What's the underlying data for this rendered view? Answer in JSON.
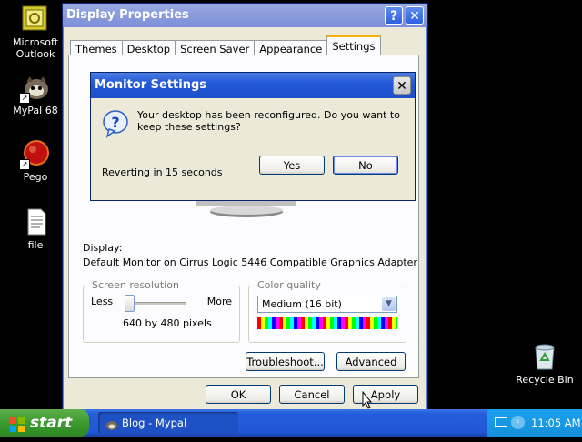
{
  "desktop": {
    "icons": [
      {
        "label_line1": "Microsoft",
        "label_line2": "Outlook",
        "icon": "outlook-icon"
      },
      {
        "label_line1": "MyPal 68",
        "label_line2": "",
        "icon": "mypal-icon"
      },
      {
        "label_line1": "Pego",
        "label_line2": "",
        "icon": "pego-icon"
      },
      {
        "label_line1": "file",
        "label_line2": "",
        "icon": "file-icon"
      },
      {
        "label_line1": "Recycle Bin",
        "label_line2": "",
        "icon": "recycle-bin-icon"
      }
    ]
  },
  "display_properties": {
    "title": "Display Properties",
    "tabs": [
      "Themes",
      "Desktop",
      "Screen Saver",
      "Appearance",
      "Settings"
    ],
    "active_tab": "Settings",
    "display_label": "Display:",
    "display_value": "Default Monitor on Cirrus Logic 5446 Compatible Graphics Adapter",
    "screen_resolution": {
      "group_label": "Screen resolution",
      "less": "Less",
      "more": "More",
      "value": "640 by 480 pixels",
      "slider_level": 0
    },
    "color_quality": {
      "group_label": "Color quality",
      "selected": "Medium (16 bit)"
    },
    "troubleshoot_label": "Troubleshoot...",
    "advanced_label": "Advanced",
    "ok_label": "OK",
    "cancel_label": "Cancel",
    "apply_label": "Apply"
  },
  "monitor_settings": {
    "title": "Monitor Settings",
    "message": "Your desktop has been reconfigured.  Do you want to keep these settings?",
    "countdown": "Reverting in 15 seconds",
    "yes_label": "Yes",
    "no_label": "No"
  },
  "taskbar": {
    "start_label": "start",
    "task_label": "Blog - Mypal",
    "clock": "11:05 AM"
  },
  "colors": {
    "title_blue": "#2358d8",
    "start_green": "#3c9a2f",
    "taskbar_blue": "#245edb"
  }
}
